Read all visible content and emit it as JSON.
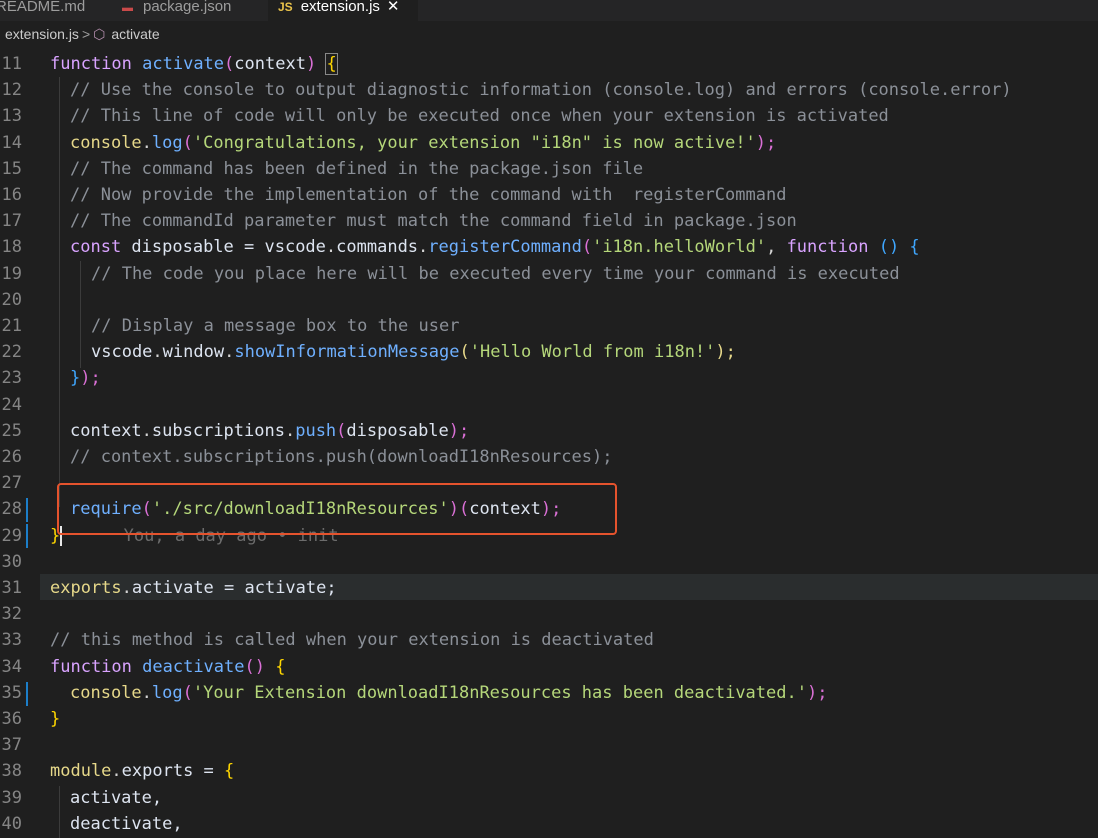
{
  "tabs": [
    {
      "label": "README.md"
    },
    {
      "label": "package.json"
    },
    {
      "label": "extension.js",
      "icon": "JS"
    }
  ],
  "breadcrumb": {
    "file": "extension.js",
    "separator": ">",
    "symbol": "activate"
  },
  "lines": {
    "l11": "11",
    "l12": "12",
    "l13": "13",
    "l14": "14",
    "l15": "15",
    "l16": "16",
    "l17": "17",
    "l18": "18",
    "l19": "19",
    "l20": "20",
    "l21": "21",
    "l22": "22",
    "l23": "23",
    "l24": "24",
    "l25": "25",
    "l26": "26",
    "l27": "27",
    "l28": "28",
    "l29": "29",
    "l30": "30",
    "l31": "31",
    "l32": "32",
    "l33": "33",
    "l34": "34",
    "l35": "35",
    "l36": "36",
    "l37": "37",
    "l38": "38",
    "l39": "39",
    "l40": "40"
  },
  "code": {
    "l11": {
      "kw": "function",
      "fn": "activate",
      "p1": "(",
      "arg": "context",
      "p2": ")",
      "b": "{"
    },
    "l12": "// Use the console to output diagnostic information (console.log) and errors (console.error)",
    "l13": "// This line of code will only be executed once when your extension is activated",
    "l14": {
      "obj": "console",
      "dot": ".",
      "fn": "log",
      "p1": "(",
      "str": "'Congratulations, your extension \"i18n\" is now active!'",
      "p2": ");"
    },
    "l15": "// The command has been defined in the package.json file",
    "l16": "// Now provide the implementation of the command with  registerCommand",
    "l17": "// The commandId parameter must match the command field in package.json",
    "l18": {
      "kw": "const",
      "v": " disposable = ",
      "obj": "vscode",
      "d1": ".",
      "o2": "commands",
      "d2": ".",
      "fn": "registerCommand",
      "p1": "(",
      "str": "'i18n.helloWorld'",
      "c": ", ",
      "kw2": "function",
      "sp": " ",
      "p3": "()",
      "b": " {"
    },
    "l19": "// The code you place here will be executed every time your command is executed",
    "l21": "// Display a message box to the user",
    "l22": {
      "obj": "vscode",
      "d1": ".",
      "o2": "window",
      "d2": ".",
      "fn": "showInformationMessage",
      "p1": "(",
      "str": "'Hello World from i18n!'",
      "p2": ");"
    },
    "l23": {
      "b": "}",
      "p": ");"
    },
    "l25": {
      "obj": "context",
      "d1": ".",
      "o2": "subscriptions",
      "d2": ".",
      "fn": "push",
      "p1": "(",
      "arg": "disposable",
      "p2": ");"
    },
    "l26": "// context.subscriptions.push(downloadI18nResources);",
    "l28": {
      "fn": "require",
      "p1": "(",
      "str": "'./src/downloadI18nResources'",
      "p2": ")(",
      "arg": "context",
      "p3": ");"
    },
    "l29": {
      "b": "}",
      "blame": "You, a day ago • init"
    },
    "l31": {
      "obj": "exports",
      "d": ".",
      "v": "activate = activate;"
    },
    "l33": "// this method is called when your extension is deactivated",
    "l34": {
      "kw": "function",
      "fn": "deactivate",
      "p": "()",
      "b": " {"
    },
    "l35": {
      "obj": "console",
      "d": ".",
      "fn": "log",
      "p1": "(",
      "str": "'Your Extension downloadI18nResources has been deactivated.'",
      "p2": ");"
    },
    "l36": {
      "b": "}"
    },
    "l38": {
      "obj": "module",
      "d": ".",
      "v": "exports = ",
      "b": "{"
    },
    "l39": "activate,",
    "l40": "deactivate,"
  }
}
